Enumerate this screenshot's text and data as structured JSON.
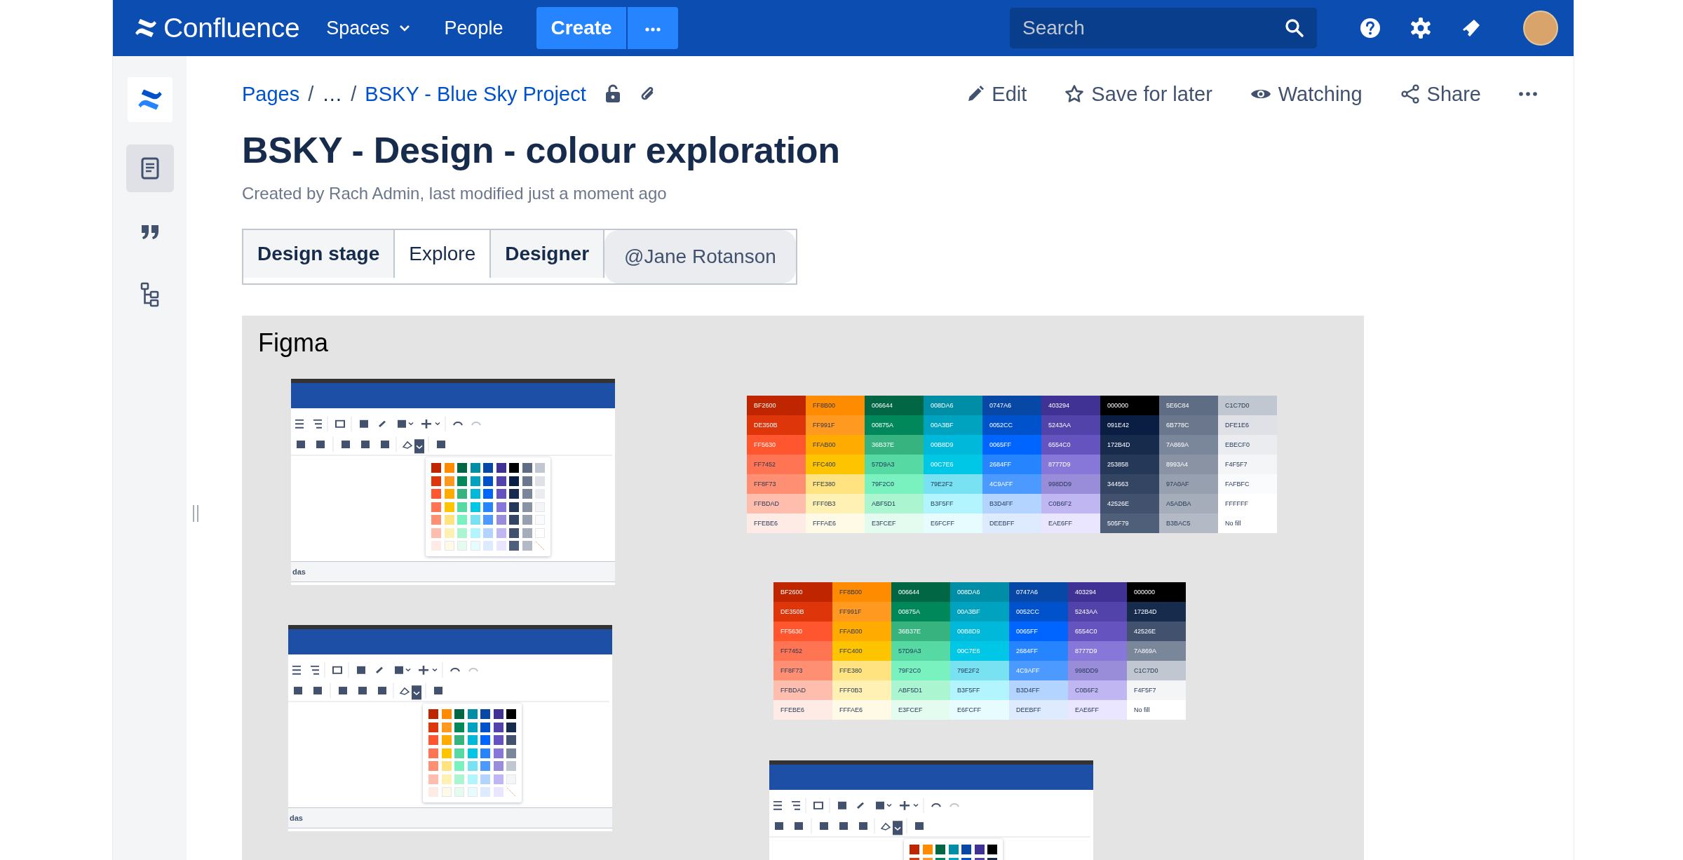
{
  "top_nav": {
    "logo": "Confluence",
    "links": [
      {
        "label": "Spaces",
        "dropdown": true
      },
      {
        "label": "People",
        "dropdown": false
      }
    ],
    "create_button": "Create",
    "search": {
      "placeholder": "Search"
    }
  },
  "sidebar": {
    "items": [
      {
        "kind": "pages",
        "selected": true
      },
      {
        "kind": "blog",
        "selected": false
      },
      {
        "kind": "tree",
        "selected": false
      }
    ]
  },
  "breadcrumbs": {
    "separator": "/",
    "items": [
      "Pages",
      "…",
      "BSKY - Blue Sky Project"
    ]
  },
  "page_actions": [
    {
      "kind": "edit",
      "label": "Edit"
    },
    {
      "kind": "save",
      "label": "Save for later"
    },
    {
      "kind": "watch",
      "label": "Watching"
    },
    {
      "kind": "share",
      "label": "Share"
    },
    {
      "kind": "more"
    }
  ],
  "title": "BSKY - Design - colour exploration",
  "byline": "Created by Rach Admin, last modified just a moment ago",
  "page_properties": [
    {
      "kind": "header",
      "text": "Design stage"
    },
    {
      "kind": "value",
      "text": "Explore"
    },
    {
      "kind": "header",
      "text": "Designer"
    },
    {
      "kind": "mention",
      "text": "@Jane Rotanson"
    }
  ],
  "figma": {
    "label": "Figma",
    "palettes": [
      {
        "columns": [
          [
            {
              "label": "BF2600",
              "color": "#bf2600"
            },
            {
              "label": "DE350B",
              "color": "#de350b"
            },
            {
              "label": "FF5630",
              "color": "#ff5630"
            },
            {
              "label": "FF7452",
              "color": "#ff7452"
            },
            {
              "label": "FF8F73",
              "color": "#ff8f73"
            },
            {
              "label": "FFBDAD",
              "color": "#ffbdad"
            },
            {
              "label": "FFEBE6",
              "color": "#ffebe6"
            }
          ],
          [
            {
              "label": "FF8B00",
              "color": "#ff8b00"
            },
            {
              "label": "FF991F",
              "color": "#ff991f"
            },
            {
              "label": "FFAB00",
              "color": "#ffab00"
            },
            {
              "label": "FFC400",
              "color": "#ffc400"
            },
            {
              "label": "FFE380",
              "color": "#ffe380"
            },
            {
              "label": "FFF0B3",
              "color": "#fff0b3"
            },
            {
              "label": "FFFAE6",
              "color": "#fffae6"
            }
          ],
          [
            {
              "label": "006644",
              "color": "#006644"
            },
            {
              "label": "00875A",
              "color": "#00875a"
            },
            {
              "label": "36B37E",
              "color": "#36b37e"
            },
            {
              "label": "57D9A3",
              "color": "#57d9a3"
            },
            {
              "label": "79F2C0",
              "color": "#79f2c0"
            },
            {
              "label": "ABF5D1",
              "color": "#abf5d1"
            },
            {
              "label": "E3FCEF",
              "color": "#e3fcef"
            }
          ],
          [
            {
              "label": "008DA6",
              "color": "#008da6"
            },
            {
              "label": "00A3BF",
              "color": "#00a3bf"
            },
            {
              "label": "00B8D9",
              "color": "#00b8d9"
            },
            {
              "label": "00C7E6",
              "color": "#00c7e6"
            },
            {
              "label": "79E2F2",
              "color": "#79e2f2"
            },
            {
              "label": "B3F5FF",
              "color": "#b3f5ff"
            },
            {
              "label": "E6FCFF",
              "color": "#e6fcff"
            }
          ],
          [
            {
              "label": "0747A6",
              "color": "#0747a6"
            },
            {
              "label": "0052CC",
              "color": "#0052cc"
            },
            {
              "label": "0065FF",
              "color": "#0065ff"
            },
            {
              "label": "2684FF",
              "color": "#2684ff"
            },
            {
              "label": "4C9AFF",
              "color": "#4c9aff"
            },
            {
              "label": "B3D4FF",
              "color": "#b3d4ff"
            },
            {
              "label": "DEEBFF",
              "color": "#deebff"
            }
          ],
          [
            {
              "label": "403294",
              "color": "#403294"
            },
            {
              "label": "5243AA",
              "color": "#5243aa"
            },
            {
              "label": "6554C0",
              "color": "#6554c0"
            },
            {
              "label": "8777D9",
              "color": "#8777d9"
            },
            {
              "label": "998DD9",
              "color": "#998dd9"
            },
            {
              "label": "C0B6F2",
              "color": "#c0b6f2"
            },
            {
              "label": "EAE6FF",
              "color": "#eae6ff"
            }
          ],
          [
            {
              "label": "000000",
              "color": "#000000"
            },
            {
              "label": "091E42",
              "color": "#091e42"
            },
            {
              "label": "172B4D",
              "color": "#172b4d"
            },
            {
              "label": "253858",
              "color": "#253858"
            },
            {
              "label": "344563",
              "color": "#344563"
            },
            {
              "label": "42526E",
              "color": "#42526e"
            },
            {
              "label": "505F79",
              "color": "#505f79"
            }
          ],
          [
            {
              "label": "5E6C84",
              "color": "#5e6c84"
            },
            {
              "label": "6B778C",
              "color": "#6b778c"
            },
            {
              "label": "7A869A",
              "color": "#7a869a"
            },
            {
              "label": "8993A4",
              "color": "#8993a4"
            },
            {
              "label": "97A0AF",
              "color": "#97a0af"
            },
            {
              "label": "A5ADBA",
              "color": "#a5adba"
            },
            {
              "label": "B3BAC5",
              "color": "#b3bac5"
            }
          ],
          [
            {
              "label": "C1C7D0",
              "color": "#c1c7d0"
            },
            {
              "label": "DFE1E6",
              "color": "#dfe1e6"
            },
            {
              "label": "EBECF0",
              "color": "#ebecf0"
            },
            {
              "label": "F4F5F7",
              "color": "#f4f5f7"
            },
            {
              "label": "FAFBFC",
              "color": "#fafbfc"
            },
            {
              "label": "FFFFFF",
              "color": "#ffffff"
            },
            {
              "label": "No fill",
              "color": "#ffffff",
              "no_fill": true
            }
          ]
        ]
      },
      {
        "columns": [
          [
            {
              "label": "BF2600",
              "color": "#bf2600"
            },
            {
              "label": "DE350B",
              "color": "#de350b"
            },
            {
              "label": "FF5630",
              "color": "#ff5630"
            },
            {
              "label": "FF7452",
              "color": "#ff7452"
            },
            {
              "label": "FF8F73",
              "color": "#ff8f73"
            },
            {
              "label": "FFBDAD",
              "color": "#ffbdad"
            },
            {
              "label": "FFEBE6",
              "color": "#ffebe6"
            }
          ],
          [
            {
              "label": "FF8B00",
              "color": "#ff8b00"
            },
            {
              "label": "FF991F",
              "color": "#ff991f"
            },
            {
              "label": "FFAB00",
              "color": "#ffab00"
            },
            {
              "label": "FFC400",
              "color": "#ffc400"
            },
            {
              "label": "FFE380",
              "color": "#ffe380"
            },
            {
              "label": "FFF0B3",
              "color": "#fff0b3"
            },
            {
              "label": "FFFAE6",
              "color": "#fffae6"
            }
          ],
          [
            {
              "label": "006644",
              "color": "#006644"
            },
            {
              "label": "00875A",
              "color": "#00875a"
            },
            {
              "label": "36B37E",
              "color": "#36b37e"
            },
            {
              "label": "57D9A3",
              "color": "#57d9a3"
            },
            {
              "label": "79F2C0",
              "color": "#79f2c0"
            },
            {
              "label": "ABF5D1",
              "color": "#abf5d1"
            },
            {
              "label": "E3FCEF",
              "color": "#e3fcef"
            }
          ],
          [
            {
              "label": "008DA6",
              "color": "#008da6"
            },
            {
              "label": "00A3BF",
              "color": "#00a3bf"
            },
            {
              "label": "00B8D9",
              "color": "#00b8d9"
            },
            {
              "label": "00C7E6",
              "color": "#00c7e6"
            },
            {
              "label": "79E2F2",
              "color": "#79e2f2"
            },
            {
              "label": "B3F5FF",
              "color": "#b3f5ff"
            },
            {
              "label": "E6FCFF",
              "color": "#e6fcff"
            }
          ],
          [
            {
              "label": "0747A6",
              "color": "#0747a6"
            },
            {
              "label": "0052CC",
              "color": "#0052cc"
            },
            {
              "label": "0065FF",
              "color": "#0065ff"
            },
            {
              "label": "2684FF",
              "color": "#2684ff"
            },
            {
              "label": "4C9AFF",
              "color": "#4c9aff"
            },
            {
              "label": "B3D4FF",
              "color": "#b3d4ff"
            },
            {
              "label": "DEEBFF",
              "color": "#deebff"
            }
          ],
          [
            {
              "label": "403294",
              "color": "#403294"
            },
            {
              "label": "5243AA",
              "color": "#5243aa"
            },
            {
              "label": "6554C0",
              "color": "#6554c0"
            },
            {
              "label": "8777D9",
              "color": "#8777d9"
            },
            {
              "label": "998DD9",
              "color": "#998dd9"
            },
            {
              "label": "C0B6F2",
              "color": "#c0b6f2"
            },
            {
              "label": "EAE6FF",
              "color": "#eae6ff"
            }
          ],
          [
            {
              "label": "000000",
              "color": "#000000"
            },
            {
              "label": "172B4D",
              "color": "#172b4d"
            },
            {
              "label": "42526E",
              "color": "#42526e"
            },
            {
              "label": "7A869A",
              "color": "#7a869a"
            },
            {
              "label": "C1C7D0",
              "color": "#c1c7d0"
            },
            {
              "label": "F4F5F7",
              "color": "#f4f5f7"
            },
            {
              "label": "No fill",
              "color": "#ffffff",
              "no_fill": true
            }
          ]
        ]
      }
    ],
    "editor_mockups": [
      {
        "picker_open": true,
        "table_text": "das"
      },
      {
        "picker_open": true,
        "table_text": "das"
      },
      {
        "picker_open": true
      }
    ]
  }
}
